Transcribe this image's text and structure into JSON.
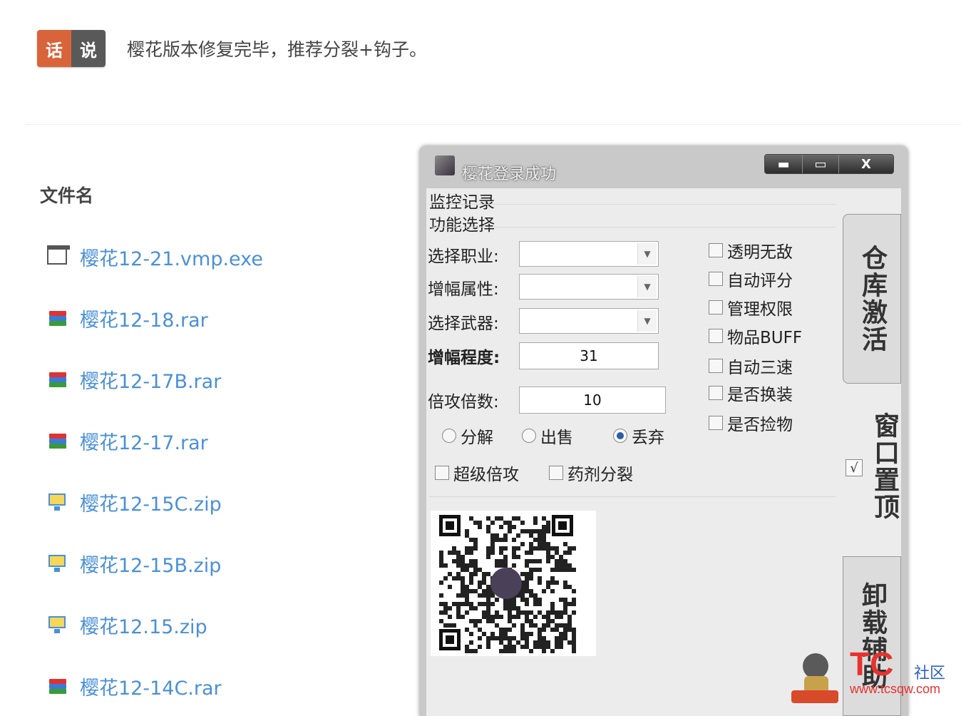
{
  "header": {
    "badge_left": "话",
    "badge_right": "说",
    "announcement": "樱花版本修复完毕，推荐分裂+钩子。"
  },
  "files": {
    "title": "文件名",
    "items": [
      {
        "name": "樱花12-21.vmp.exe",
        "icon": "exe-file-icon"
      },
      {
        "name": "樱花12-18.rar",
        "icon": "rar-archive-icon"
      },
      {
        "name": "樱花12-17B.rar",
        "icon": "rar-archive-icon"
      },
      {
        "name": "樱花12-17.rar",
        "icon": "rar-archive-icon"
      },
      {
        "name": "樱花12-15C.zip",
        "icon": "zip-archive-icon"
      },
      {
        "name": "樱花12-15B.zip",
        "icon": "zip-archive-icon"
      },
      {
        "name": "樱花12.15.zip",
        "icon": "zip-archive-icon"
      },
      {
        "name": "樱花12-14C.rar",
        "icon": "rar-archive-icon"
      }
    ]
  },
  "window": {
    "title": "樱花登录成功",
    "minimize": "▬",
    "maximize": "▭",
    "close": "X",
    "tabs": {
      "monitor": "监控记录",
      "features": "功能选择"
    },
    "fields": {
      "job_label": "选择职业:",
      "job_value": "",
      "attr_label": "增幅属性:",
      "attr_value": "",
      "weapon_label": "选择武器:",
      "weapon_value": "",
      "level_label": "增幅程度:",
      "level_value": "31",
      "multiplier_label": "倍攻倍数:",
      "multiplier_value": "10"
    },
    "radios": {
      "decompose": "分解",
      "sell": "出售",
      "discard": "丢弃",
      "selected": "discard"
    },
    "checks_bottom": {
      "super_attack": "超级倍攻",
      "potion_split": "药剂分裂"
    },
    "checks_right": [
      "透明无敌",
      "自动评分",
      "管理权限",
      "物品BUFF",
      "自动三速",
      "是否换装",
      "是否捡物"
    ],
    "side": {
      "warehouse": "仓库激活",
      "topmost": "窗口置顶",
      "topmost_checked": "√",
      "uninstall": "卸载辅助"
    }
  },
  "watermark": {
    "logo": "TC",
    "community": "社区",
    "url": "www.tcsqw.com"
  }
}
